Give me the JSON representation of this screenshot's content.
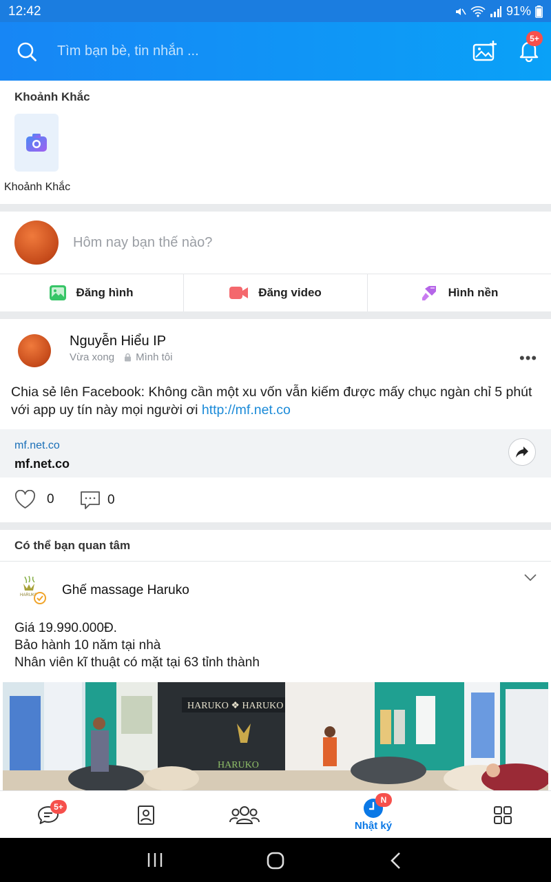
{
  "status_bar": {
    "time": "12:42",
    "battery": "91%"
  },
  "header": {
    "search_placeholder": "Tìm bạn bè, tin nhắn ...",
    "notification_badge": "5+"
  },
  "moments": {
    "title": "Khoảnh Khắc",
    "tile_caption": "Khoảnh Khắc"
  },
  "composer": {
    "prompt": "Hôm nay bạn thế nào?",
    "actions": [
      {
        "label": "Đăng hình",
        "icon": "image-icon"
      },
      {
        "label": "Đăng video",
        "icon": "video-icon"
      },
      {
        "label": "Hình nền",
        "icon": "brush-icon"
      }
    ]
  },
  "post": {
    "author": "Nguyễn Hiểu IP",
    "time": "Vừa xong",
    "privacy": "Mình tôi",
    "text": "Chia sẻ lên Facebook: Không cần một xu vốn vẫn kiếm được mấy chục ngàn chỉ 5 phút với app uy tín này mọi người ơi ",
    "link": "http://mf.net.co",
    "preview": {
      "domain_small": "mf.net.co",
      "domain_big": "mf.net.co"
    },
    "likes": "0",
    "comments": "0"
  },
  "suggestions": {
    "title": "Có thể bạn quan tâm",
    "ad": {
      "name": "Ghế massage Haruko",
      "lines": [
        "Giá 19.990.000Đ.",
        "Bảo hành 10 năm tại nhà",
        "Nhân viên kĩ thuật có mặt tại 63 tỉnh thành"
      ],
      "logo_text": "HARUKO",
      "photo_sign": "HARUKO ❖ HARUKO",
      "photo_logo": "HARUKO"
    }
  },
  "bottom_nav": {
    "messages_badge": "5+",
    "diary_badge": "N",
    "diary_label": "Nhật ký"
  },
  "colors": {
    "brand": "#0a78e6",
    "badge": "#f6504c",
    "link": "#1a8ad8"
  }
}
